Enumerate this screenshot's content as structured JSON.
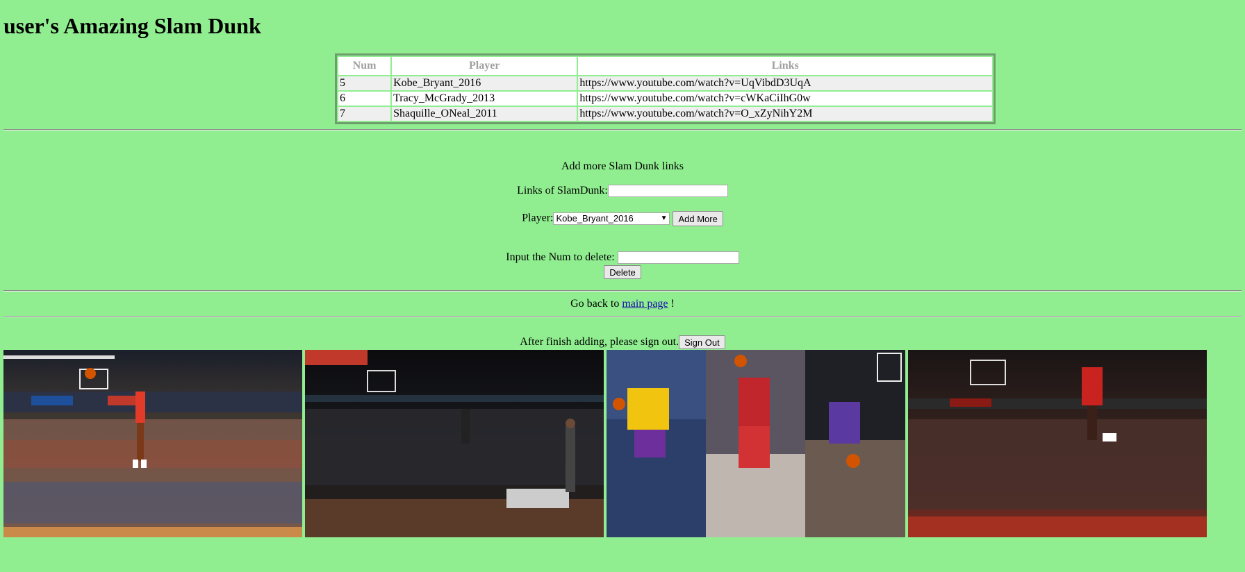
{
  "page": {
    "title": "user's Amazing Slam Dunk"
  },
  "table": {
    "headers": [
      "Num",
      "Player",
      "Links"
    ],
    "rows": [
      {
        "num": "5",
        "player": "Kobe_Bryant_2016",
        "link": "https://www.youtube.com/watch?v=UqVibdD3UqA"
      },
      {
        "num": "6",
        "player": "Tracy_McGrady_2013",
        "link": "https://www.youtube.com/watch?v=cWKaCiIhG0w"
      },
      {
        "num": "7",
        "player": "Shaquille_ONeal_2011",
        "link": "https://www.youtube.com/watch?v=O_xZyNihY2M"
      }
    ]
  },
  "add_form": {
    "heading": "Add more Slam Dunk links",
    "links_label": "Links of SlamDunk:",
    "links_value": "",
    "player_label": "Player:",
    "player_selected": "Kobe_Bryant_2016",
    "add_button": "Add More"
  },
  "delete_form": {
    "label": "Input the Num to delete:",
    "value": "",
    "delete_button": "Delete"
  },
  "back": {
    "prefix": "Go back to",
    "link_text": "main page",
    "suffix": "!"
  },
  "signout": {
    "text": "After finish adding, please sign out.",
    "button": "Sign Out"
  },
  "photos": [
    {
      "icon": "dunk-photo-red-jersey"
    },
    {
      "icon": "dunk-photo-dark-arena"
    },
    {
      "icon": "dunk-photo-collage"
    },
    {
      "icon": "dunk-photo-red-jersey-23"
    }
  ],
  "colors": {
    "background": "#90ee90",
    "header_text": "#a0a0a0"
  }
}
